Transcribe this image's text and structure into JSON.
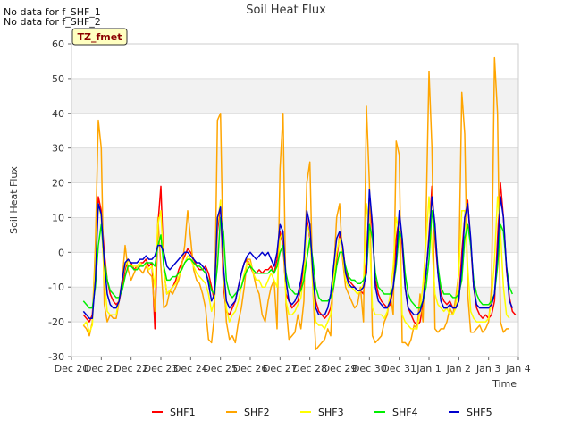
{
  "notes": [
    "No data for f_SHF_1",
    "No data for f_SHF_2"
  ],
  "badge": "TZ_fmet",
  "chart_data": {
    "type": "line",
    "title": "Soil Heat Flux",
    "xlabel": "Time",
    "ylabel": "Soil Heat Flux",
    "ylim": [
      -30,
      60
    ],
    "yticks": [
      -30,
      -20,
      -10,
      0,
      10,
      20,
      30,
      40,
      50,
      60
    ],
    "xlim": [
      0,
      15
    ],
    "xticks": [
      0,
      1,
      2,
      3,
      4,
      5,
      6,
      7,
      8,
      9,
      10,
      11,
      12,
      13,
      14,
      15
    ],
    "xtick_labels": [
      "Dec 20",
      "Dec 21",
      "Dec 22",
      "Dec 23",
      "Dec 24",
      "Dec 25",
      "Dec 26",
      "Dec 27",
      "Dec 28",
      "Dec 29",
      "Dec 30",
      "Dec 31",
      "Jan 1",
      "Jan 2",
      "Jan 3",
      "Jan 4"
    ],
    "grid": "horizontal bands",
    "legend_position": "bottom",
    "x": [
      0.4,
      0.5,
      0.6,
      0.7,
      0.8,
      0.9,
      1.0,
      1.1,
      1.2,
      1.3,
      1.4,
      1.5,
      1.6,
      1.7,
      1.8,
      1.9,
      2.0,
      2.1,
      2.2,
      2.3,
      2.4,
      2.5,
      2.6,
      2.7,
      2.8,
      2.9,
      3.0,
      3.1,
      3.2,
      3.3,
      3.4,
      3.5,
      3.6,
      3.7,
      3.8,
      3.9,
      4.0,
      4.1,
      4.2,
      4.3,
      4.4,
      4.5,
      4.6,
      4.7,
      4.8,
      4.9,
      5.0,
      5.1,
      5.2,
      5.3,
      5.4,
      5.5,
      5.6,
      5.7,
      5.8,
      5.9,
      6.0,
      6.1,
      6.2,
      6.3,
      6.4,
      6.5,
      6.6,
      6.7,
      6.8,
      6.9,
      7.0,
      7.1,
      7.2,
      7.3,
      7.4,
      7.5,
      7.6,
      7.7,
      7.8,
      7.9,
      8.0,
      8.1,
      8.2,
      8.3,
      8.4,
      8.5,
      8.6,
      8.7,
      8.8,
      8.9,
      9.0,
      9.1,
      9.2,
      9.3,
      9.4,
      9.5,
      9.6,
      9.7,
      9.8,
      9.9,
      10.0,
      10.1,
      10.2,
      10.3,
      10.4,
      10.5,
      10.6,
      10.7,
      10.8,
      10.9,
      11.0,
      11.1,
      11.2,
      11.3,
      11.4,
      11.5,
      11.6,
      11.7,
      11.8,
      11.9,
      12.0,
      12.1,
      12.2,
      12.3,
      12.4,
      12.5,
      12.6,
      12.7,
      12.8,
      12.9,
      13.0,
      13.1,
      13.2,
      13.3,
      13.4,
      13.5,
      13.6,
      13.7,
      13.8,
      13.9,
      14.0,
      14.1,
      14.2,
      14.3,
      14.4,
      14.5,
      14.6,
      14.7,
      14.8,
      14.9,
      15.0
    ],
    "series": [
      {
        "name": "SHF1",
        "color": "#ff0000",
        "values": [
          -18,
          -19,
          -20,
          -18,
          -5,
          16,
          12,
          0,
          -8,
          -12,
          -14,
          -15,
          -14,
          -10,
          -5,
          -2,
          -3,
          -5,
          -4,
          -3,
          -3,
          -2,
          -4,
          -3,
          -22,
          8,
          19,
          -5,
          -12,
          -11,
          -10,
          -8,
          -5,
          -3,
          -1,
          1,
          0,
          -2,
          -4,
          -5,
          -5,
          -4,
          -6,
          -10,
          -14,
          6,
          14,
          -10,
          -17,
          -18,
          -16,
          -14,
          -10,
          -6,
          -3,
          -2,
          -4,
          -6,
          -6,
          -5,
          -6,
          -5,
          -5,
          -4,
          -6,
          -2,
          6,
          2,
          -12,
          -14,
          -16,
          -15,
          -14,
          -10,
          -4,
          10,
          4,
          -6,
          -14,
          -17,
          -18,
          -19,
          -18,
          -16,
          -10,
          -2,
          5,
          2,
          -5,
          -8,
          -9,
          -10,
          -11,
          -11,
          -12,
          -2,
          16,
          6,
          -8,
          -12,
          -14,
          -15,
          -16,
          -15,
          -10,
          4,
          10,
          2,
          -10,
          -16,
          -18,
          -20,
          -21,
          -20,
          -15,
          -6,
          5,
          19,
          4,
          -6,
          -12,
          -14,
          -15,
          -14,
          -16,
          -16,
          -14,
          0,
          10,
          15,
          2,
          -10,
          -16,
          -18,
          -19,
          -18,
          -19,
          -18,
          -14,
          4,
          20,
          10,
          -5,
          -13,
          -17,
          -18
        ]
      },
      {
        "name": "SHF2",
        "color": "#ffa500",
        "values": [
          -21,
          -22,
          -24,
          -20,
          2,
          38,
          30,
          -15,
          -20,
          -18,
          -19,
          -19,
          -14,
          -8,
          2,
          -5,
          -8,
          -6,
          -4,
          -5,
          -6,
          -4,
          -6,
          -7,
          -17,
          10,
          -4,
          -16,
          -15,
          -11,
          -12,
          -10,
          -8,
          -4,
          2,
          12,
          4,
          -5,
          -8,
          -9,
          -12,
          -16,
          -25,
          -26,
          -18,
          38,
          40,
          -5,
          -20,
          -25,
          -24,
          -26,
          -20,
          -16,
          -10,
          -2,
          -2,
          -6,
          -10,
          -12,
          -18,
          -20,
          -14,
          -10,
          -8,
          -22,
          24,
          40,
          -15,
          -25,
          -24,
          -23,
          -18,
          -22,
          -14,
          20,
          26,
          -10,
          -28,
          -27,
          -26,
          -25,
          -22,
          -24,
          -6,
          10,
          14,
          -2,
          -10,
          -12,
          -14,
          -16,
          -15,
          -10,
          -20,
          42,
          20,
          -24,
          -26,
          -25,
          -24,
          -20,
          -18,
          -12,
          -18,
          32,
          28,
          -26,
          -26,
          -27,
          -25,
          -21,
          -22,
          -12,
          -20,
          10,
          52,
          30,
          -22,
          -23,
          -22,
          -22,
          -20,
          -16,
          -18,
          -13,
          -6,
          46,
          34,
          -12,
          -23,
          -23,
          -22,
          -21,
          -23,
          -22,
          -20,
          -10,
          56,
          40,
          -20,
          -23,
          -22,
          -22
        ]
      },
      {
        "name": "SHF3",
        "color": "#ffff00",
        "values": [
          -21,
          -20,
          -23,
          -21,
          -3,
          14,
          10,
          -8,
          -17,
          -18,
          -18,
          -18,
          -13,
          -8,
          -4,
          -2,
          -4,
          -4,
          -4,
          -3,
          -4,
          -3,
          -5,
          -4,
          -10,
          8,
          12,
          -5,
          -12,
          -11,
          -10,
          -9,
          -7,
          -5,
          -3,
          -1,
          -2,
          -4,
          -6,
          -7,
          -8,
          -9,
          -12,
          -17,
          -14,
          8,
          15,
          -6,
          -16,
          -20,
          -18,
          -17,
          -14,
          -10,
          -6,
          -3,
          -3,
          -6,
          -8,
          -8,
          -10,
          -10,
          -8,
          -6,
          -8,
          -10,
          4,
          6,
          -14,
          -18,
          -18,
          -17,
          -15,
          -13,
          -6,
          8,
          5,
          -10,
          -20,
          -21,
          -21,
          -22,
          -20,
          -18,
          -8,
          0,
          4,
          0,
          -8,
          -10,
          -10,
          -11,
          -12,
          -11,
          -9,
          14,
          6,
          -16,
          -18,
          -18,
          -18,
          -19,
          -17,
          -12,
          -4,
          10,
          6,
          -18,
          -20,
          -21,
          -22,
          -22,
          -22,
          -17,
          -9,
          3,
          16,
          2,
          -12,
          -15,
          -16,
          -17,
          -16,
          -18,
          -18,
          -16,
          -6,
          12,
          12,
          -4,
          -17,
          -19,
          -20,
          -20,
          -20,
          -20,
          -19,
          -14,
          -2,
          16,
          6,
          -10,
          -18,
          -19
        ]
      },
      {
        "name": "SHF4",
        "color": "#00ee00",
        "values": [
          -14,
          -15,
          -16,
          -16,
          -10,
          2,
          8,
          -2,
          -8,
          -11,
          -12,
          -13,
          -13,
          -11,
          -7,
          -4,
          -4,
          -5,
          -5,
          -4,
          -4,
          -3,
          -3,
          -3,
          -4,
          2,
          5,
          -4,
          -8,
          -8,
          -7,
          -7,
          -6,
          -5,
          -3,
          -2,
          -2,
          -3,
          -4,
          -4,
          -5,
          -6,
          -8,
          -11,
          -12,
          -4,
          10,
          6,
          -8,
          -12,
          -13,
          -12,
          -11,
          -10,
          -7,
          -5,
          -4,
          -5,
          -6,
          -6,
          -6,
          -6,
          -6,
          -5,
          -6,
          -4,
          0,
          2,
          -6,
          -10,
          -11,
          -12,
          -12,
          -11,
          -8,
          -2,
          4,
          -2,
          -10,
          -13,
          -14,
          -14,
          -14,
          -13,
          -10,
          -4,
          0,
          0,
          -4,
          -7,
          -8,
          -8,
          -9,
          -9,
          -8,
          -6,
          8,
          4,
          -6,
          -10,
          -11,
          -12,
          -12,
          -12,
          -10,
          -4,
          6,
          4,
          -6,
          -12,
          -14,
          -15,
          -16,
          -16,
          -14,
          -10,
          -2,
          12,
          6,
          -4,
          -10,
          -12,
          -12,
          -12,
          -13,
          -13,
          -12,
          -8,
          4,
          8,
          2,
          -8,
          -12,
          -14,
          -15,
          -15,
          -15,
          -14,
          -12,
          -4,
          8,
          6,
          -4,
          -10,
          -12
        ]
      },
      {
        "name": "SHF5",
        "color": "#0000cd",
        "values": [
          -17,
          -18,
          -19,
          -19,
          -8,
          14,
          11,
          -3,
          -12,
          -15,
          -16,
          -16,
          -14,
          -8,
          -3,
          -2,
          -3,
          -3,
          -3,
          -2,
          -2,
          -1,
          -2,
          -2,
          -1,
          2,
          2,
          0,
          -4,
          -5,
          -4,
          -3,
          -2,
          -1,
          0,
          0,
          -1,
          -2,
          -3,
          -3,
          -4,
          -5,
          -9,
          -14,
          -12,
          10,
          13,
          -4,
          -14,
          -16,
          -15,
          -14,
          -10,
          -6,
          -3,
          -1,
          0,
          -1,
          -2,
          -1,
          0,
          -1,
          0,
          -2,
          -4,
          0,
          8,
          6,
          -8,
          -14,
          -15,
          -14,
          -12,
          -8,
          -2,
          12,
          8,
          -6,
          -16,
          -18,
          -18,
          -18,
          -16,
          -12,
          -4,
          4,
          6,
          2,
          -6,
          -9,
          -10,
          -10,
          -11,
          -11,
          -10,
          -6,
          18,
          8,
          -10,
          -14,
          -15,
          -16,
          -16,
          -14,
          -10,
          -2,
          12,
          4,
          -10,
          -16,
          -17,
          -18,
          -18,
          -17,
          -14,
          -6,
          4,
          16,
          8,
          -6,
          -14,
          -16,
          -16,
          -15,
          -16,
          -16,
          -14,
          -4,
          10,
          14,
          4,
          -10,
          -15,
          -16,
          -16,
          -16,
          -16,
          -15,
          -12,
          0,
          16,
          10,
          -4,
          -14,
          -16
        ]
      }
    ]
  }
}
